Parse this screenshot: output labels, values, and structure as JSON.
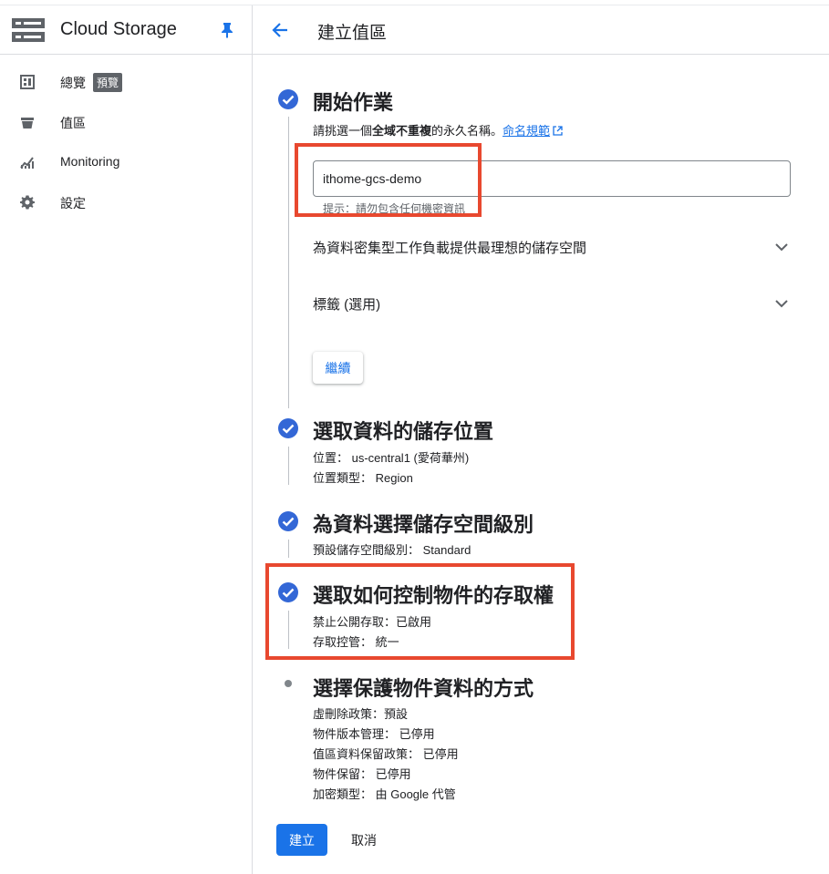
{
  "colors": {
    "accent": "#1a73e8",
    "step_complete": "#3367d6",
    "annotation": "#e8482f"
  },
  "sidebar": {
    "product_title": "Cloud Storage",
    "product_icon": "storage-icon",
    "pin_icon": "pin-icon",
    "items": [
      {
        "label": "總覽",
        "icon": "overview-icon",
        "badge": "預覽"
      },
      {
        "label": "值區",
        "icon": "bucket-icon"
      },
      {
        "label": "Monitoring",
        "icon": "monitoring-icon"
      },
      {
        "label": "設定",
        "icon": "gear-icon"
      }
    ]
  },
  "header": {
    "title": "建立值區",
    "back_icon": "arrow-back-icon"
  },
  "steps": [
    {
      "title": "開始作業",
      "status": "complete",
      "intro_prefix": "請挑選一個",
      "intro_bold": "全域不重複",
      "intro_suffix": "的永久名稱。",
      "naming_link": "命名規範",
      "name_value": "ithome-gcs-demo",
      "hint": "提示：請勿包含任何機密資訊",
      "expanders": [
        "為資料密集型工作負載提供最理想的儲存空間",
        "標籤 (選用)"
      ],
      "continue_label": "繼續"
    },
    {
      "title": "選取資料的儲存位置",
      "status": "complete",
      "details": [
        "位置： us-central1 (愛荷華州)",
        "位置類型： Region"
      ]
    },
    {
      "title": "為資料選擇儲存空間級別",
      "status": "complete",
      "details": [
        "預設儲存空間級別： Standard"
      ]
    },
    {
      "title": "選取如何控制物件的存取權",
      "status": "complete",
      "details": [
        "禁止公開存取：已啟用",
        "存取控管： 統一"
      ]
    },
    {
      "title": "選擇保護物件資料的方式",
      "status": "pending",
      "details": [
        "虛刪除政策：預設",
        "物件版本管理： 已停用",
        "值區資料保留政策： 已停用",
        "物件保留： 已停用",
        "加密類型： 由 Google 代管"
      ]
    }
  ],
  "actions": {
    "create": "建立",
    "cancel": "取消"
  }
}
